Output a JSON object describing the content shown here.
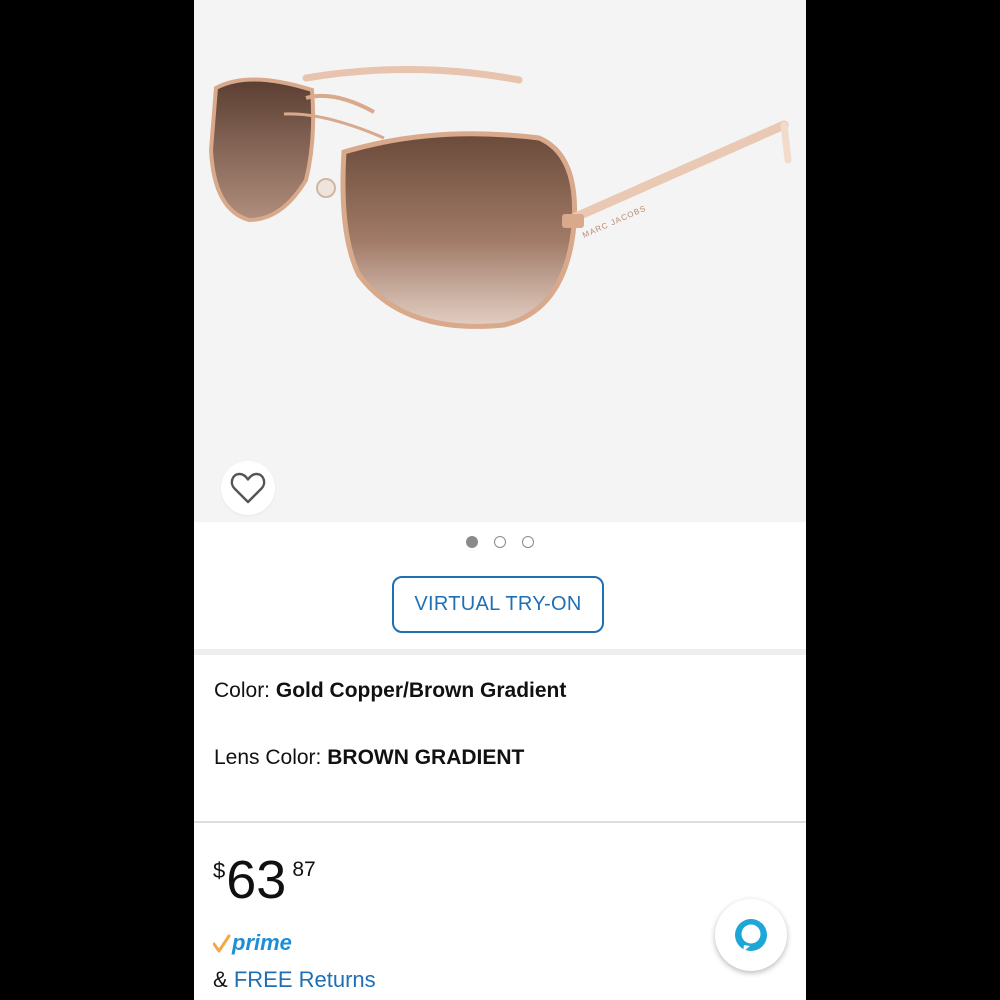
{
  "product": {
    "frame_brand_engraving": "MARC JACOBS"
  },
  "carousel": {
    "total": 3,
    "active_index": 1
  },
  "buttons": {
    "virtual_try_on": "VIRTUAL TRY-ON"
  },
  "attributes": {
    "color_label": "Color:",
    "color_value": "Gold Copper/Brown Gradient",
    "lens_label": "Lens Color:",
    "lens_value": "BROWN GRADIENT"
  },
  "price": {
    "symbol": "$",
    "whole": "63",
    "fraction": "87"
  },
  "shipping": {
    "prime_label": "prime",
    "returns_prefix": "&",
    "returns_link": "FREE Returns"
  },
  "icons": {
    "wishlist": "heart-outline-icon",
    "prime_check": "prime-check-icon",
    "assistant": "alexa-icon"
  },
  "colors": {
    "accent_blue": "#1f6fb4",
    "prime_blue": "#1f8dd6",
    "prime_orange": "#f3a847",
    "frame_rose_gold": "#d9a98c",
    "lens_brown": "#6a4a3a"
  }
}
